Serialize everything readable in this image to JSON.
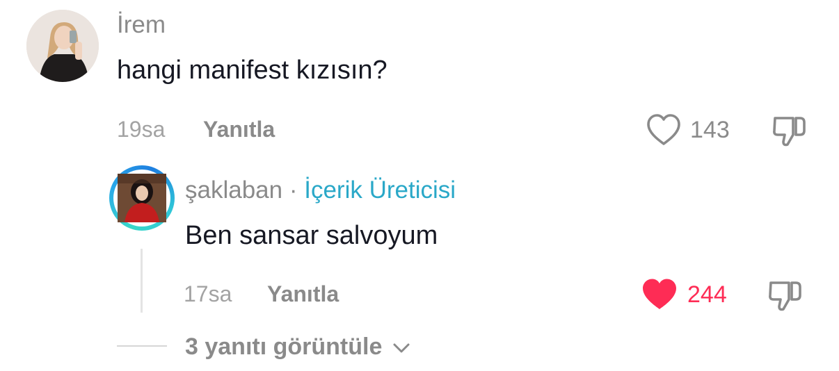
{
  "comment": {
    "username": "İrem",
    "text": "hangi manifest kızısın?",
    "time": "19sa",
    "reply_label": "Yanıtla",
    "like_count": "143",
    "liked": false
  },
  "reply": {
    "username": "şaklaban",
    "separator": "·",
    "creator_label": "İçerik Üreticisi",
    "text": "Ben sansar salvoyum",
    "time": "17sa",
    "reply_label": "Yanıtla",
    "like_count": "244",
    "liked": true
  },
  "view_replies": {
    "label": "3 yanıtı görüntüle"
  },
  "colors": {
    "liked_heart": "#fe2c55",
    "creator_accent": "#2aa8c8",
    "muted_text": "#8a8a8a",
    "primary_text": "#161823"
  },
  "icons": {
    "like": "heart-icon",
    "dislike": "thumbs-down-icon",
    "expand": "chevron-down-icon"
  }
}
